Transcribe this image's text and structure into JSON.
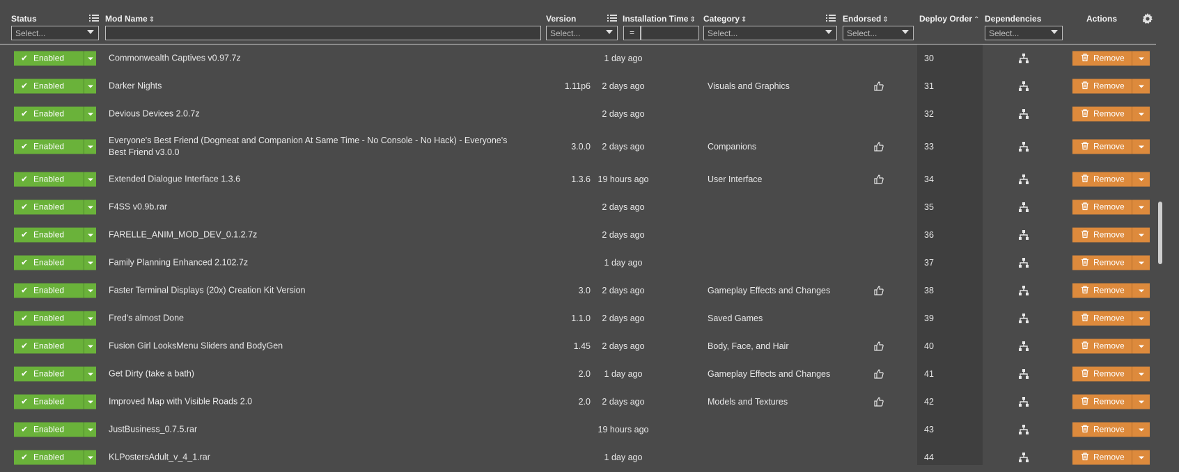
{
  "columns": {
    "status": "Status",
    "mod_name": "Mod Name",
    "version": "Version",
    "installation_time": "Installation Time",
    "category": "Category",
    "endorsed": "Endorsed",
    "deploy_order": "Deploy Order",
    "dependencies": "Dependencies",
    "actions": "Actions"
  },
  "filters": {
    "status_placeholder": "Select...",
    "version_placeholder": "Select...",
    "time_operator": "=",
    "category_placeholder": "Select...",
    "endorsed_placeholder": "Select...",
    "dependencies_placeholder": "Select..."
  },
  "labels": {
    "enabled": "Enabled",
    "remove": "Remove"
  },
  "colors": {
    "enabled_green": "#6ab23a",
    "remove_orange": "#dd8a3c",
    "background": "#4a4a4a"
  },
  "rows": [
    {
      "name": "Commonwealth Captives v0.97.7z",
      "version": "",
      "time": "1 day ago",
      "category": "",
      "endorsed": false,
      "order": "30"
    },
    {
      "name": "Darker Nights",
      "version": "1.11p6",
      "time": "2 days ago",
      "category": "Visuals and Graphics",
      "endorsed": true,
      "order": "31"
    },
    {
      "name": "Devious Devices 2.0.7z",
      "version": "",
      "time": "2 days ago",
      "category": "",
      "endorsed": false,
      "order": "32"
    },
    {
      "name": "Everyone's Best Friend (Dogmeat and Companion At Same Time - No Console - No Hack) - Everyone's Best Friend v3.0.0",
      "version": "3.0.0",
      "time": "2 days ago",
      "category": "Companions",
      "endorsed": true,
      "order": "33"
    },
    {
      "name": "Extended Dialogue Interface 1.3.6",
      "version": "1.3.6",
      "time": "19 hours ago",
      "category": "User Interface",
      "endorsed": true,
      "order": "34"
    },
    {
      "name": "F4SS v0.9b.rar",
      "version": "",
      "time": "2 days ago",
      "category": "",
      "endorsed": false,
      "order": "35"
    },
    {
      "name": "FARELLE_ANIM_MOD_DEV_0.1.2.7z",
      "version": "",
      "time": "2 days ago",
      "category": "",
      "endorsed": false,
      "order": "36"
    },
    {
      "name": "Family Planning Enhanced 2.102.7z",
      "version": "",
      "time": "1 day ago",
      "category": "",
      "endorsed": false,
      "order": "37"
    },
    {
      "name": "Faster Terminal Displays (20x) Creation Kit Version",
      "version": "3.0",
      "time": "2 days ago",
      "category": "Gameplay Effects and Changes",
      "endorsed": true,
      "order": "38"
    },
    {
      "name": "Fred's almost Done",
      "version": "1.1.0",
      "time": "2 days ago",
      "category": "Saved Games",
      "endorsed": false,
      "order": "39"
    },
    {
      "name": "Fusion Girl LooksMenu Sliders and BodyGen",
      "version": "1.45",
      "time": "2 days ago",
      "category": "Body, Face, and Hair",
      "endorsed": true,
      "order": "40"
    },
    {
      "name": "Get Dirty (take a bath)",
      "version": "2.0",
      "time": "1 day ago",
      "category": "Gameplay Effects and Changes",
      "endorsed": true,
      "order": "41"
    },
    {
      "name": "Improved Map with Visible Roads 2.0",
      "version": "2.0",
      "time": "2 days ago",
      "category": "Models and Textures",
      "endorsed": true,
      "order": "42"
    },
    {
      "name": "JustBusiness_0.7.5.rar",
      "version": "",
      "time": "19 hours ago",
      "category": "",
      "endorsed": false,
      "order": "43"
    },
    {
      "name": "KLPostersAdult_v_4_1.rar",
      "version": "",
      "time": "1 day ago",
      "category": "",
      "endorsed": false,
      "order": "44"
    }
  ]
}
